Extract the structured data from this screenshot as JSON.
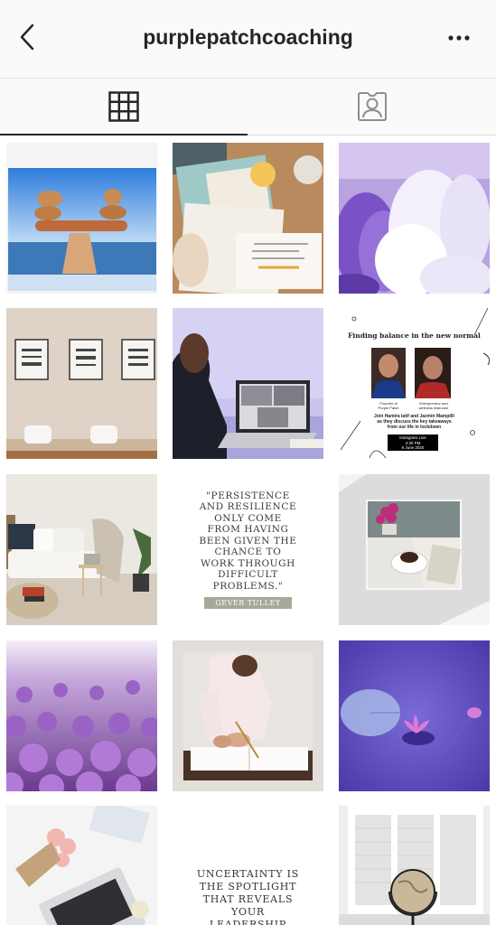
{
  "header": {
    "title": "purplepatchcoaching",
    "back_icon": "chevron-left-icon",
    "more_icon": "more-horizontal-icon"
  },
  "tabs": [
    {
      "name": "posts-grid",
      "icon": "grid-icon",
      "active": true
    },
    {
      "name": "tagged",
      "icon": "tagged-person-icon",
      "active": false
    }
  ],
  "posts": {
    "quote_persistence": {
      "text": "\"PERSISTENCE\nAND RESILIENCE\nONLY COME\nFROM HAVING\nBEEN GIVEN THE\nCHANCE TO\nWORK THROUGH\nDIFFICULT\nPROBLEMS.\"",
      "author": "GEVER TULLEY"
    },
    "quote_uncertainty": {
      "text": "UNCERTAINTY IS\nTHE SPOTLIGHT\nTHAT REVEALS\nYOUR\nLEADERSHIP"
    },
    "event": {
      "title": "Finding balance in the new normal",
      "caption_left": "Founder of\nPurple Patch",
      "caption_right": "Entrepreneur and\nwellness instructor",
      "description": "Join Hamira latif and Jazmin Mampilli\nas they discuss the key takeaways\nfrom our life in lockdown",
      "badge": "Instagram Live\n4:30 PM\n6 June 2020"
    }
  },
  "colors": {
    "accent_purple": "#7b5fc4",
    "text": "#262626"
  }
}
